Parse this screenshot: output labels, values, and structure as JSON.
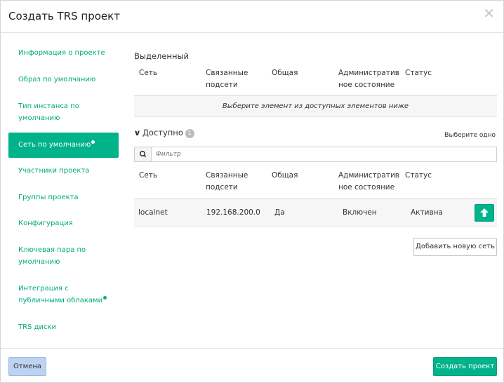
{
  "dialog": {
    "title": "Создать TRS проект",
    "close_glyph": "✕"
  },
  "sidebar": {
    "items": [
      {
        "label": "Информация о проекте",
        "active": false,
        "dot": false
      },
      {
        "label": "Образ по умолчанию",
        "active": false,
        "dot": false
      },
      {
        "label": "Тип инстанса по умолчанию",
        "active": false,
        "dot": false
      },
      {
        "label": "Сеть по умолчанию",
        "active": true,
        "dot": true
      },
      {
        "label": "Участники проекта",
        "active": false,
        "dot": false
      },
      {
        "label": "Группы проекта",
        "active": false,
        "dot": false
      },
      {
        "label": "Конфигурация",
        "active": false,
        "dot": false
      },
      {
        "label": "Ключевая пара по умолчанию",
        "active": false,
        "dot": false
      },
      {
        "label": "Интеграция с публичными облаками",
        "active": false,
        "dot": true
      },
      {
        "label": "TRS диски",
        "active": false,
        "dot": false
      }
    ]
  },
  "allocated": {
    "title": "Выделенный",
    "columns": {
      "network": "Сеть",
      "subnets": "Связанные подсети",
      "shared": "Общая",
      "admin_state": "Административное состояние",
      "status": "Статус"
    },
    "empty_message": "Выберите элемент из доступных элементов ниже"
  },
  "available": {
    "title": "Доступно",
    "count": "1",
    "select_hint": "Выберите одно",
    "filter_placeholder": "Фильтр",
    "columns": {
      "network": "Сеть",
      "subnets": "Связанные подсети",
      "shared": "Общая",
      "admin_state": "Административное состояние",
      "status": "Статус"
    },
    "rows": [
      {
        "network": "localnet",
        "subnets": "192.168.200.0",
        "shared": "Да",
        "admin_state": "Включен",
        "status": "Активна"
      }
    ]
  },
  "buttons": {
    "add_network": "Добавить новую сеть",
    "cancel": "Отмена",
    "create": "Создать проект"
  },
  "colors": {
    "accent": "#00b38a",
    "cancel_bg": "#bcd3f1"
  }
}
